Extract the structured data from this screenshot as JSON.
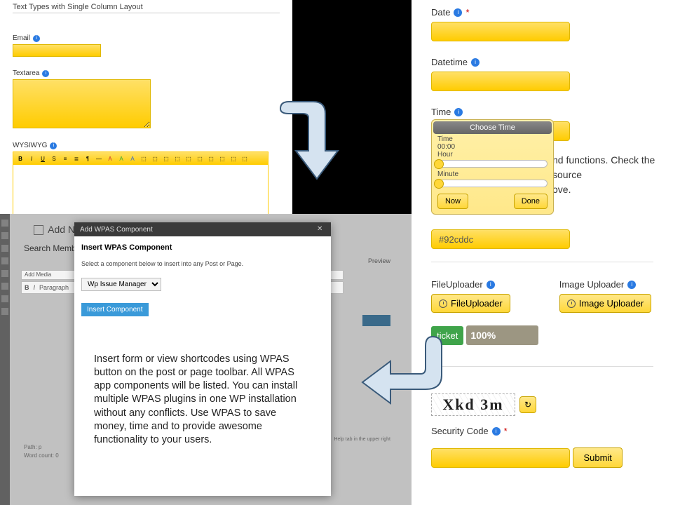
{
  "topform": {
    "title": "Text Types with Single Column Layout",
    "email_label": "Email",
    "textarea_label": "Textarea",
    "wysiwyg_label": "WYSIWYG"
  },
  "wysiwyg_toolbar": [
    "B",
    "I",
    "U",
    "S",
    "•",
    "1.",
    "¶",
    "—",
    "A",
    "A",
    "A",
    "⬚",
    "⬚",
    "⬚",
    "⬚",
    "⬚",
    "⬚",
    "⬚",
    "⬚",
    "⬚",
    "⬚"
  ],
  "wpadmin": {
    "page_heading": "Add New",
    "search_label": "Search Membe",
    "add_media": "Add Media",
    "paragraph": "Paragraph",
    "preview": "Preview",
    "hint": "Help tab in the upper right",
    "path": "Path: p",
    "wordcount": "Word count: 0"
  },
  "modal": {
    "titlebar": "Add WPAS Component",
    "heading": "Insert WPAS Component",
    "subtext": "Select a component below to insert into any Post or Page.",
    "select_value": "Wp Issue Manager",
    "insert_btn": "Insert Component",
    "blurb": "Insert form or view shortcodes using WPAS button on the post or page toolbar. All WPAS app components will be listed. You can install multiple WPAS plugins in one WP installation without any conflicts. Use WPAS to save money, time and to provide awesome functionality to your users."
  },
  "rightform": {
    "date_label": "Date",
    "datetime_label": "Datetime",
    "time_label": "Time",
    "color_value": "#92cddc",
    "fileuploader_label": "FileUploader",
    "imageuploader_label": "Image Uploader",
    "fileuploader_btn": "FileUploader",
    "imageuploader_btn": "Image Uploader",
    "ticket": "ticket",
    "progress": "100%",
    "captcha_text": "Xkd 3m",
    "security_label": "Security Code",
    "submit": "Submit",
    "overflow1": "nd functions. Check the source",
    "overflow2": "ove."
  },
  "timepicker": {
    "header": "Choose Time",
    "time_label": "Time",
    "time_value": "00:00",
    "hour_label": "Hour",
    "minute_label": "Minute",
    "now": "Now",
    "done": "Done"
  }
}
